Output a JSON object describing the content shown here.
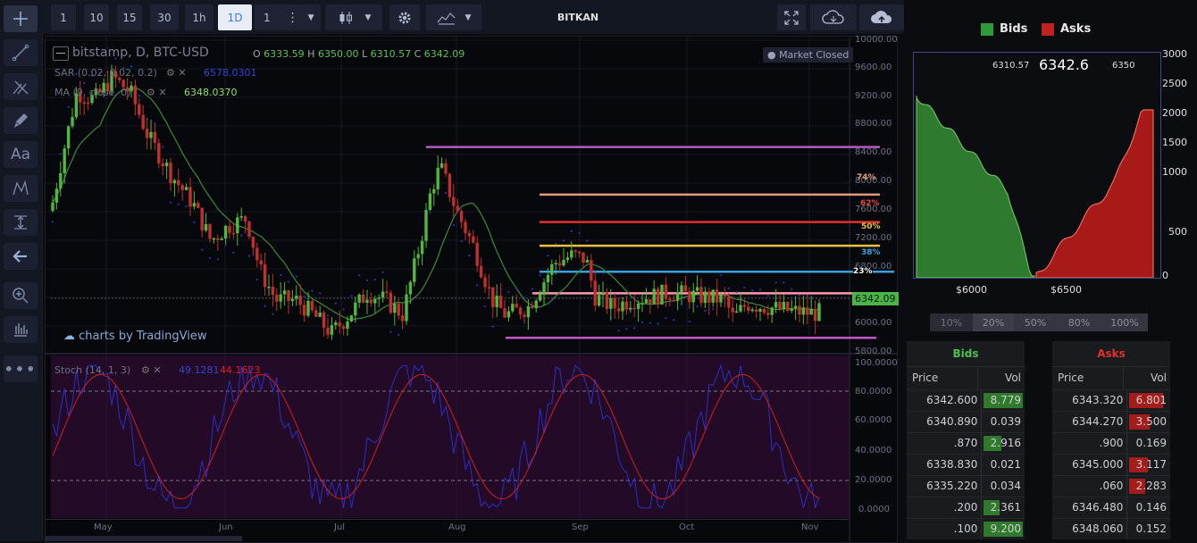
{
  "toolbar": {
    "intervals": [
      "1",
      "10",
      "15",
      "30",
      "1h",
      "1D",
      "1"
    ],
    "title": "BITKAN"
  },
  "chart": {
    "symbol": "bitstamp, D, BTC-USD",
    "ohlc": {
      "o_label": "O",
      "o": "6333.59",
      "h_label": "H",
      "h": "6350.00",
      "l_label": "L",
      "l": "6310.57",
      "c_label": "C",
      "c": "6342.09"
    },
    "market_status": "Market Closed",
    "sar_label": "SAR (0.02, 0.02, 0.2)",
    "sar_value": "6578.0301",
    "ma_label": "MA (9, close, 0)",
    "ma_value": "6348.0370",
    "last_price": "6342.09",
    "watermark": "charts by TradingView",
    "price_axis": [
      "10000.00",
      "9600.00",
      "9200.00",
      "8800.00",
      "8400.00",
      "8000.00",
      "7600.00",
      "7200.00",
      "6800.00",
      "6342.09",
      "6000.00",
      "5800.00"
    ],
    "fib_labels": [
      "74%",
      "62%",
      "50%",
      "38%",
      "23%"
    ],
    "months": [
      "May",
      "Jun",
      "Jul",
      "Aug",
      "Sep",
      "Oct",
      "Nov"
    ],
    "stoch_label": "Stoch (14, 1, 3)",
    "stoch_k": "49.1281",
    "stoch_d": "44.1623",
    "stoch_axis": [
      "100.0000",
      "80.0000",
      "60.0000",
      "40.0000",
      "20.0000",
      "0.0000"
    ]
  },
  "depth": {
    "legend_bids": "Bids",
    "legend_asks": "Asks",
    "low": "6310.57",
    "price": "6342.6",
    "high": "6350",
    "y_axis": [
      "3000",
      "2500",
      "2000",
      "1500",
      "1000",
      "500",
      "0"
    ],
    "x_axis": [
      "$6000",
      "$6500"
    ],
    "colors": {
      "bids": "#2e9a3a",
      "asks": "#c0221f"
    }
  },
  "percent_buttons": [
    "10%",
    "20%",
    "50%",
    "80%",
    "100%"
  ],
  "orderbook": {
    "bids": {
      "title": "Bids",
      "price_header": "Price",
      "vol_header": "Vol",
      "rows": [
        {
          "price": "6342.600",
          "vol": "8.779"
        },
        {
          "price": "6340.890",
          "vol": "0.039"
        },
        {
          "price": ".870",
          "vol": "2.916"
        },
        {
          "price": "6338.830",
          "vol": "0.021"
        },
        {
          "price": "6335.220",
          "vol": "0.034"
        },
        {
          "price": ".200",
          "vol": "2.361"
        },
        {
          "price": ".100",
          "vol": "9.200"
        }
      ]
    },
    "asks": {
      "title": "Asks",
      "price_header": "Price",
      "vol_header": "Vol",
      "rows": [
        {
          "price": "6343.320",
          "vol": "6.801"
        },
        {
          "price": "6344.270",
          "vol": "3.500"
        },
        {
          "price": ".900",
          "vol": "0.169"
        },
        {
          "price": "6345.000",
          "vol": "3.117"
        },
        {
          "price": ".060",
          "vol": "2.283"
        },
        {
          "price": "6346.480",
          "vol": "0.146"
        },
        {
          "price": "6348.060",
          "vol": "0.152"
        }
      ]
    }
  }
}
